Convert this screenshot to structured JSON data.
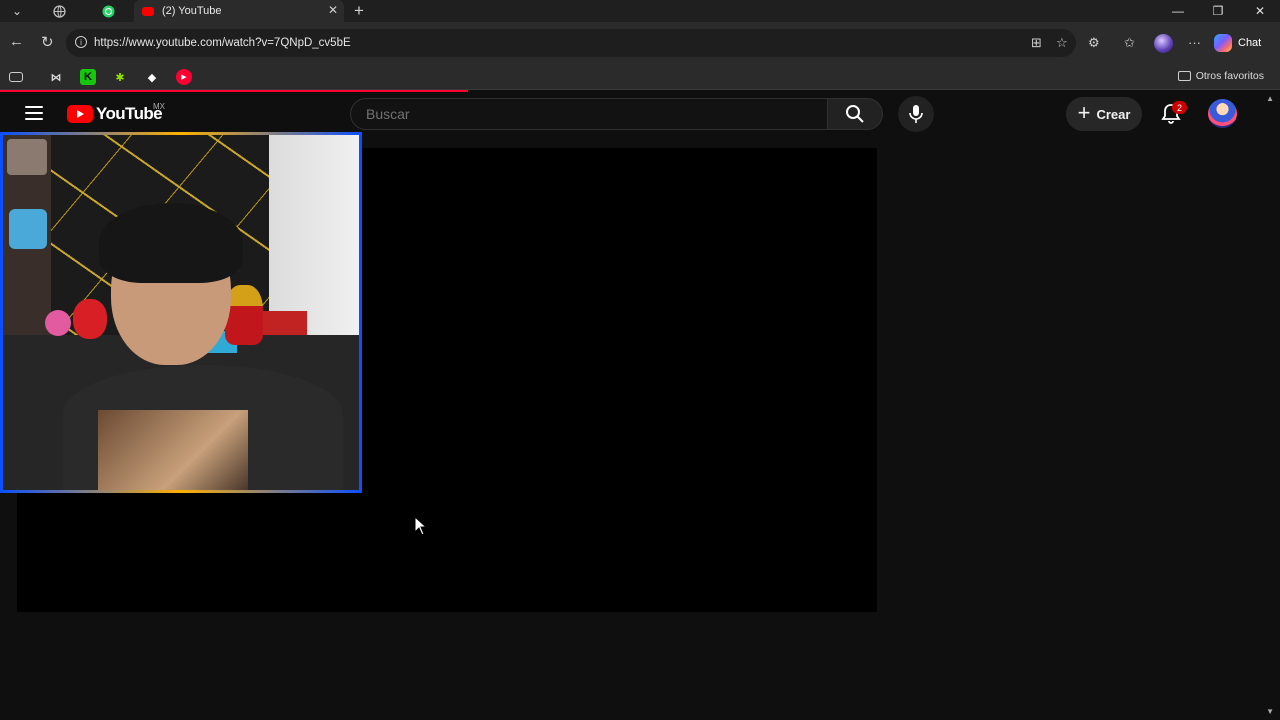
{
  "browser": {
    "tab_title": "(2) YouTube",
    "new_tab_label": "+",
    "url": "https://www.youtube.com/watch?v=7QNpD_cv5bE",
    "chat_label": "Chat",
    "favorites_label": "Otros favoritos"
  },
  "youtube": {
    "logo_text": "YouTube",
    "country_code": "MX",
    "search_placeholder": "Buscar",
    "create_label": "Crear",
    "notification_count": "2"
  },
  "colors": {
    "brand_red": "#ff0000",
    "page_background": "#0f0f0f"
  }
}
